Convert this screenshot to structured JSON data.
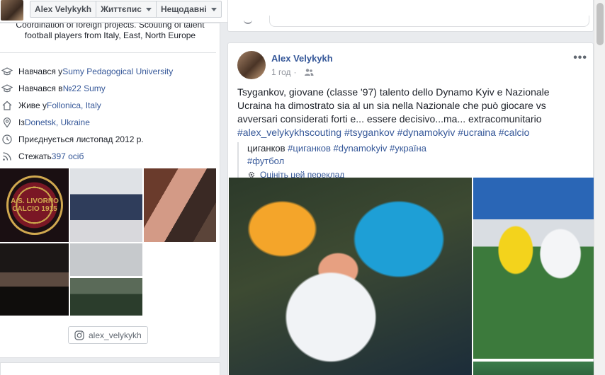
{
  "nav": {
    "profile_name": "Alex Velykykh",
    "timeline_label": "Життєпис",
    "recent_label": "Нещодавні"
  },
  "intro": {
    "bio_top_partial": "Coordination of foreign projects. Scouting of talent",
    "bio_line2": "football players from Italy, East, North Europe",
    "items": [
      {
        "prefix": "Навчався у ",
        "link": "Sumy Pedagogical University",
        "icon": "graduation-cap-icon"
      },
      {
        "prefix": "Навчався в ",
        "link": "№22 Sumy",
        "icon": "graduation-cap-icon"
      },
      {
        "prefix": "Живе у ",
        "link": "Follonica, Italy",
        "icon": "home-icon"
      },
      {
        "prefix": "Із ",
        "link": "Donetsk, Ukraine",
        "icon": "location-pin-icon"
      },
      {
        "prefix": "Приєднується листопад 2012 р.",
        "link": "",
        "icon": "clock-icon"
      },
      {
        "prefix": "Стежать ",
        "link": "397 осіб",
        "icon": "rss-icon"
      }
    ],
    "crest_text": "A.S. LIVORNO CALCIO 1915",
    "instagram_handle": "alex_velykykh"
  },
  "post": {
    "author": "Alex Velykykh",
    "time": "1 год",
    "audience_icon": "friends-icon",
    "more_label": "•••",
    "text": "Tsygankov, giovane (classe '97) talento dello Dynamo Kyiv e Nazionale Ucraina ha dimostrato sia al un sia nella Nazionale che può giocare vs avversari considerati forti e... essere decisivo...ma... extracomunitario",
    "hashtags": "#alex_velykykhscouting #tsygankov #dynamokyiv #ucraina #calcio",
    "translation_text": "циганков ",
    "translation_tags": "#циганков #dynamokyiv #україна #футбол",
    "rate_translation": "Оцініть цей переклад"
  }
}
